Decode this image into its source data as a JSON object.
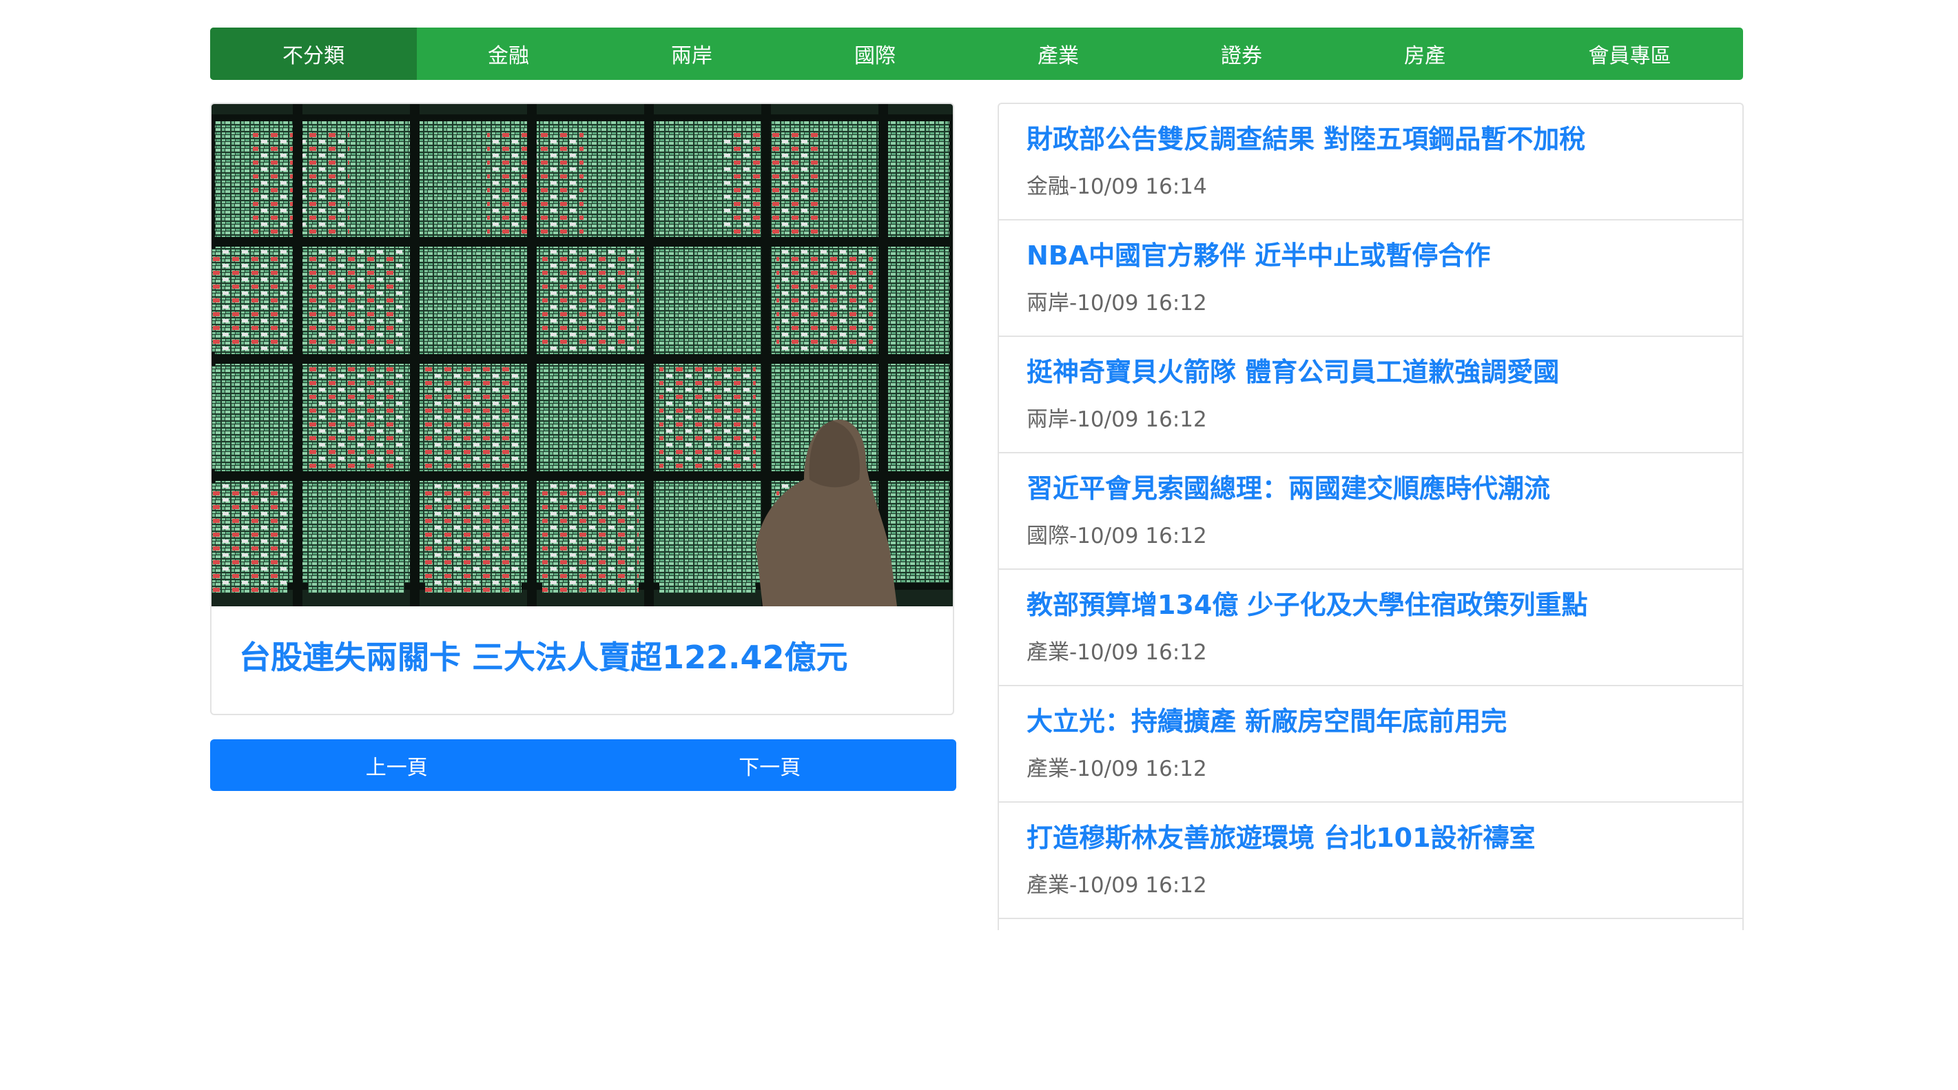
{
  "tabs": [
    {
      "label": "不分類",
      "active": true
    },
    {
      "label": "金融"
    },
    {
      "label": "兩岸"
    },
    {
      "label": "國際"
    },
    {
      "label": "產業"
    },
    {
      "label": "證券"
    },
    {
      "label": "房產"
    },
    {
      "label": "會員專區"
    }
  ],
  "feature": {
    "title": "台股連失兩關卡 三大法人賣超122.42億元"
  },
  "pager": {
    "prev_label": "上一頁",
    "next_label": "下一頁"
  },
  "news": [
    {
      "title": "財政部公告雙反調查結果 對陸五項鋼品暫不加稅",
      "meta": "金融-10/09 16:14"
    },
    {
      "title": "NBA中國官方夥伴 近半中止或暫停合作",
      "meta": "兩岸-10/09 16:12"
    },
    {
      "title": "挺神奇寶貝火箭隊 體育公司員工道歉強調愛國",
      "meta": "兩岸-10/09 16:12"
    },
    {
      "title": "習近平會見索國總理：兩國建交順應時代潮流",
      "meta": "國際-10/09 16:12"
    },
    {
      "title": "教部預算增134億 少子化及大學住宿政策列重點",
      "meta": "產業-10/09 16:12"
    },
    {
      "title": "大立光：持續擴產 新廠房空間年底前用完",
      "meta": "產業-10/09 16:12"
    },
    {
      "title": "打造穆斯林友善旅遊環境 台北101設祈禱室",
      "meta": "產業-10/09 16:12"
    }
  ],
  "colors": {
    "tab_bar": "#28a745",
    "tab_active": "#1e7e34",
    "link_blue": "#1a82f7",
    "pager_blue": "#0d7cff",
    "meta_gray": "#666666"
  }
}
